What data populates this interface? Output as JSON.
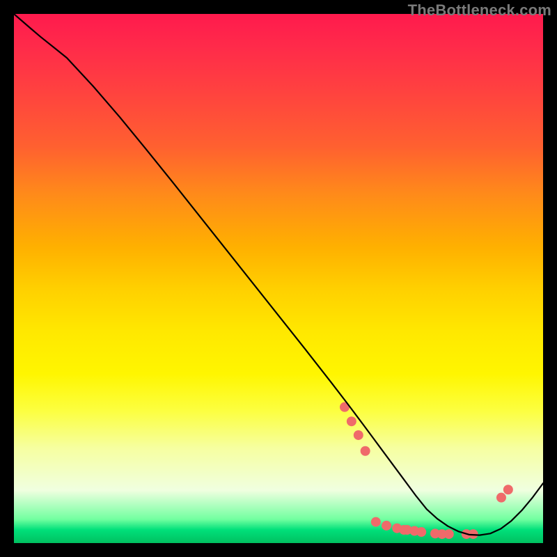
{
  "watermark": "TheBottleneck.com",
  "chart_data": {
    "type": "line",
    "title": "",
    "xlabel": "",
    "ylabel": "",
    "xlim": [
      0,
      100
    ],
    "ylim": [
      0,
      100
    ],
    "grid": false,
    "legend": false,
    "background": "gradient-red-to-green",
    "series": [
      {
        "name": "curve",
        "color": "#000000",
        "x": [
          0,
          3,
          5,
          8,
          10,
          15,
          20,
          25,
          30,
          35,
          40,
          45,
          50,
          55,
          60,
          63,
          66,
          68,
          70,
          72,
          74,
          76,
          78,
          80,
          82,
          84,
          86,
          88,
          90,
          92,
          94,
          96,
          98,
          100
        ],
        "y": [
          100.0,
          97.4,
          95.7,
          93.3,
          91.7,
          86.3,
          80.5,
          74.4,
          68.2,
          61.9,
          55.6,
          49.3,
          43.0,
          36.7,
          30.3,
          26.4,
          22.4,
          19.7,
          17.0,
          14.3,
          11.6,
          8.9,
          6.4,
          4.6,
          3.2,
          2.2,
          1.6,
          1.5,
          1.8,
          2.7,
          4.2,
          6.2,
          8.6,
          11.3
        ]
      }
    ],
    "markers": {
      "name": "dots",
      "color": "#ef6a6a",
      "radius_px": 7,
      "points": [
        {
          "x": 62.5,
          "y": 25.7
        },
        {
          "x": 63.8,
          "y": 23.0
        },
        {
          "x": 65.1,
          "y": 20.4
        },
        {
          "x": 66.4,
          "y": 17.4
        },
        {
          "x": 68.4,
          "y": 4.0
        },
        {
          "x": 70.4,
          "y": 3.3
        },
        {
          "x": 72.4,
          "y": 2.8
        },
        {
          "x": 73.7,
          "y": 2.5
        },
        {
          "x": 74.3,
          "y": 2.5
        },
        {
          "x": 75.7,
          "y": 2.3
        },
        {
          "x": 77.0,
          "y": 2.1
        },
        {
          "x": 79.6,
          "y": 1.8
        },
        {
          "x": 80.9,
          "y": 1.7
        },
        {
          "x": 82.2,
          "y": 1.7
        },
        {
          "x": 85.5,
          "y": 1.7
        },
        {
          "x": 86.8,
          "y": 1.7
        },
        {
          "x": 92.1,
          "y": 8.6
        },
        {
          "x": 93.4,
          "y": 10.1
        }
      ]
    }
  }
}
